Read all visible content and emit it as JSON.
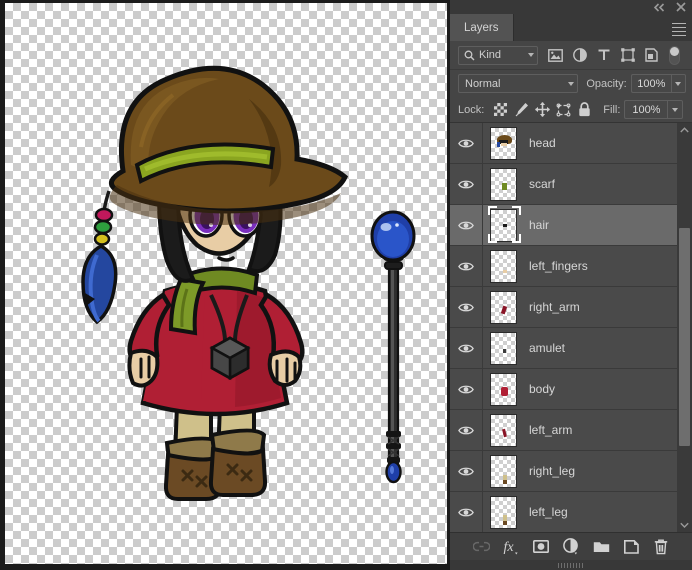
{
  "window": {
    "collapse_icon": "collapse-panel-icon",
    "close_icon": "close-icon"
  },
  "panel": {
    "tab_label": "Layers",
    "menu_icon": "panel-menu-icon"
  },
  "filter_bar": {
    "kind_label": "Kind",
    "search_icon": "search-icon",
    "icons": [
      {
        "name": "filter-pixel-layers-icon",
        "title": "Pixel layers"
      },
      {
        "name": "filter-adjustment-layers-icon",
        "title": "Adjustment layers"
      },
      {
        "name": "filter-type-layers-icon",
        "title": "Type layers"
      },
      {
        "name": "filter-shape-layers-icon",
        "title": "Shape layers"
      },
      {
        "name": "filter-smart-object-layers-icon",
        "title": "Smart objects"
      }
    ],
    "toggle_name": "filter-enable-toggle"
  },
  "blend_bar": {
    "blend_mode": "Normal",
    "opacity_label": "Opacity:",
    "opacity_value": "100%"
  },
  "lock_bar": {
    "lock_label": "Lock:",
    "fill_label": "Fill:",
    "fill_value": "100%",
    "icons": [
      {
        "name": "lock-transparent-pixels-icon"
      },
      {
        "name": "lock-image-pixels-icon"
      },
      {
        "name": "lock-position-icon"
      },
      {
        "name": "lock-artboard-nesting-icon"
      },
      {
        "name": "lock-all-icon"
      }
    ]
  },
  "layers": [
    {
      "name": "head",
      "visible": true,
      "selected": false
    },
    {
      "name": "scarf",
      "visible": true,
      "selected": false
    },
    {
      "name": "hair",
      "visible": true,
      "selected": true
    },
    {
      "name": "left_fingers",
      "visible": true,
      "selected": false
    },
    {
      "name": "right_arm",
      "visible": true,
      "selected": false
    },
    {
      "name": "amulet",
      "visible": true,
      "selected": false
    },
    {
      "name": "body",
      "visible": true,
      "selected": false
    },
    {
      "name": "left_arm",
      "visible": true,
      "selected": false
    },
    {
      "name": "right_leg",
      "visible": true,
      "selected": false
    },
    {
      "name": "left_leg",
      "visible": true,
      "selected": false
    }
  ],
  "bottom_toolbar": [
    {
      "name": "link-layers-button",
      "label": "Link layers",
      "disabled": true
    },
    {
      "name": "layer-styles-button",
      "label": "Add a layer style",
      "disabled": false
    },
    {
      "name": "layer-mask-button",
      "label": "Add layer mask",
      "disabled": false
    },
    {
      "name": "adjustment-layer-button",
      "label": "New adjustment layer",
      "disabled": false
    },
    {
      "name": "new-group-button",
      "label": "Create a new group",
      "disabled": false
    },
    {
      "name": "new-layer-button",
      "label": "Create a new layer",
      "disabled": false
    },
    {
      "name": "delete-layer-button",
      "label": "Delete layer",
      "disabled": false
    }
  ],
  "scrollbar": {
    "up_icon": "scroll-up-icon",
    "down_icon": "scroll-down-icon"
  },
  "canvas": {
    "title": "chibi-witch-character-artwork",
    "colors": {
      "hat": "#6b4a1a",
      "hat_shadow": "#4a3210",
      "hat_band": "#8aa520",
      "hair": "#1b1b1b",
      "skin": "#e8cda5",
      "eye_iris": "#7b2fbe",
      "dress": "#b01f34",
      "dress_shadow": "#8a1426",
      "scarf": "#6f8a22",
      "legging": "#cfc08a",
      "boot": "#6b4a24",
      "boot_cuff": "#8f7a4a",
      "orb": "#1f3fa8",
      "staff": "#3a3a3a",
      "amulet": "#3c3c3c",
      "outline": "#111111"
    }
  }
}
